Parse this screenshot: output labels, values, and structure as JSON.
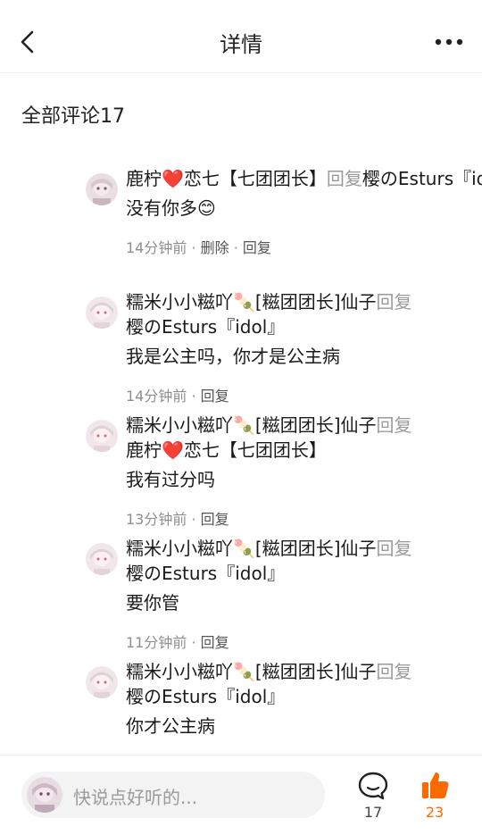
{
  "header": {
    "title": "详情"
  },
  "section": {
    "title": "全部评论17"
  },
  "comments": [
    {
      "author": "鹿柠❤️恋七【七团团长】",
      "reply_word": "回复",
      "target": "樱のEsturs『idol』",
      "content": "没有你多😊",
      "time": "14分钟前",
      "sep1": " · ",
      "delete": "删除",
      "sep2": " · ",
      "reply": "回复"
    },
    {
      "author": "糯米小小糍吖🍡[糍团团长]仙子",
      "reply_word": "回复",
      "target": "樱のEsturs『idol』",
      "content": "我是公主吗，你才是公主病",
      "time": "14分钟前",
      "sep1": " · ",
      "reply": "回复"
    },
    {
      "author": "糯米小小糍吖🍡[糍团团长]仙子",
      "reply_word": "回复",
      "target": "鹿柠❤️恋七【七团团长】",
      "content": "我有过分吗",
      "time": "13分钟前",
      "sep1": " · ",
      "reply": "回复"
    },
    {
      "author": "糯米小小糍吖🍡[糍团团长]仙子",
      "reply_word": "回复",
      "target": "樱のEsturs『idol』",
      "content": "要你管",
      "time": "11分钟前",
      "sep1": " · ",
      "reply": "回复"
    },
    {
      "author": "糯米小小糍吖🍡[糍团团长]仙子",
      "reply_word": "回复",
      "target": "樱のEsturs『idol』",
      "content": "你才公主病"
    }
  ],
  "bottom": {
    "placeholder": "快说点好听的...",
    "comment_count": "17",
    "like_count": "23"
  },
  "colors": {
    "accent": "#ff6a00",
    "muted": "#8e8e8e"
  },
  "icons": [
    "back-icon",
    "more-icon",
    "comment-icon",
    "thumbs-up-icon",
    "avatar"
  ]
}
